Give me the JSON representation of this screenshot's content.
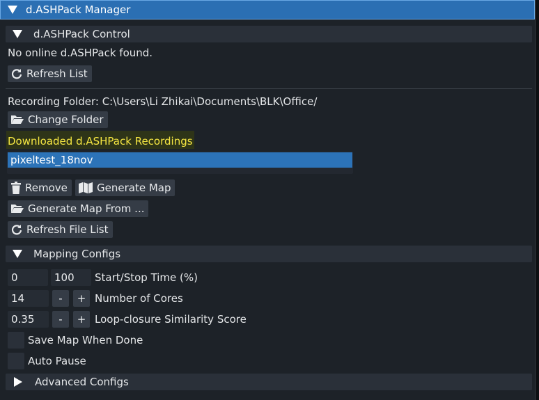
{
  "window": {
    "title": "d.ASHPack Manager"
  },
  "control": {
    "header": "d.ASHPack Control",
    "status": "No online d.ASHPack found.",
    "refresh_list": "Refresh List"
  },
  "recording": {
    "folder_label": "Recording Folder: C:\\Users\\Li Zhikai\\Documents\\BLK\\Office/",
    "change_folder": "Change Folder",
    "downloaded_title": "Downloaded d.ASHPack Recordings",
    "files": [
      "pixeltest_18nov"
    ],
    "remove": "Remove",
    "generate_map": "Generate Map",
    "generate_map_from": "Generate Map From ...",
    "refresh_file_list": "Refresh File List"
  },
  "mapping": {
    "header": "Mapping Configs",
    "start_time": "0",
    "stop_time": "100",
    "start_stop_label": "Start/Stop Time (%)",
    "cores_value": "14",
    "cores_label": "Number of Cores",
    "similarity_value": "0.35",
    "similarity_label": "Loop-closure Similarity Score",
    "minus": "-",
    "plus": "+",
    "save_map_label": "Save Map When Done",
    "auto_pause_label": "Auto Pause"
  },
  "advanced": {
    "header": "Advanced Configs"
  },
  "colors": {
    "titlebar": "#2b6fb3",
    "selection": "#2c73b8",
    "highlight_text": "#f5e642"
  },
  "icons": [
    "chevron-down-icon",
    "chevron-right-icon",
    "refresh-icon",
    "folder-open-icon",
    "trash-icon",
    "map-icon"
  ]
}
